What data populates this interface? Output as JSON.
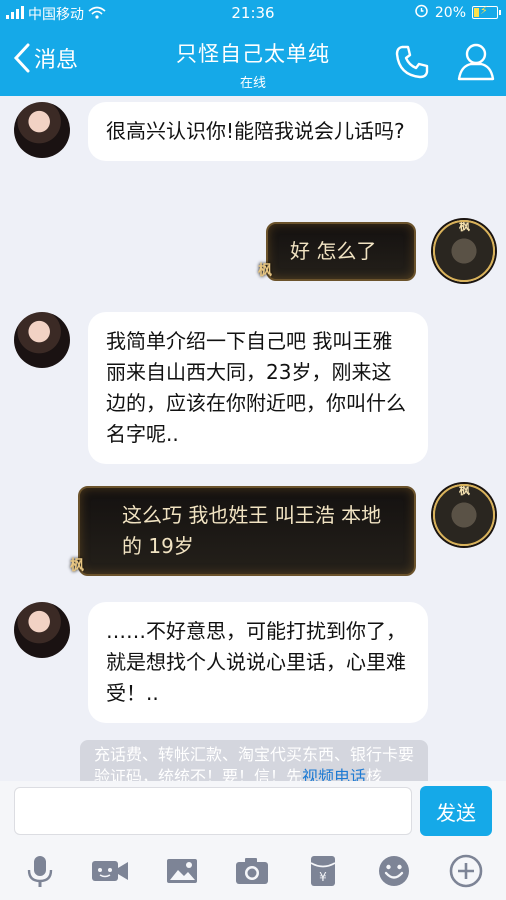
{
  "status_bar": {
    "carrier": "中国移动",
    "time": "21:36",
    "battery_percent": "20%"
  },
  "header": {
    "back_label": "消息",
    "title": "只怪自己太单纯",
    "subtitle": "在线",
    "accent_color": "#15a9e8"
  },
  "messages": [
    {
      "side": "in",
      "text": "很高兴认识你!能陪我说会儿话吗?"
    },
    {
      "side": "out",
      "text": "好 怎么了"
    },
    {
      "side": "in",
      "text": "我简单介绍一下自己吧 我叫王雅丽来自山西大同，23岁，刚来这边的，应该在你附近吧，你叫什么名字呢.."
    },
    {
      "side": "out",
      "text": "这么巧 我也姓王 叫王浩 本地的 19岁"
    },
    {
      "side": "in",
      "text": "……不好意思，可能打扰到你了，就是想找个人说说心里话，心里难受！.."
    }
  ],
  "notice": {
    "text": "充话费、转帐汇款、淘宝代买东西、银行卡要验证码，统统不！要！信！先",
    "link": "视频电话",
    "tail": "核"
  },
  "input": {
    "placeholder": "",
    "send_label": "发送"
  },
  "toolbar": {
    "icons": [
      "microphone-icon",
      "video-icon",
      "image-icon",
      "camera-icon",
      "red-packet-icon",
      "emoji-icon",
      "plus-icon"
    ]
  },
  "avatar_badge": "枫"
}
